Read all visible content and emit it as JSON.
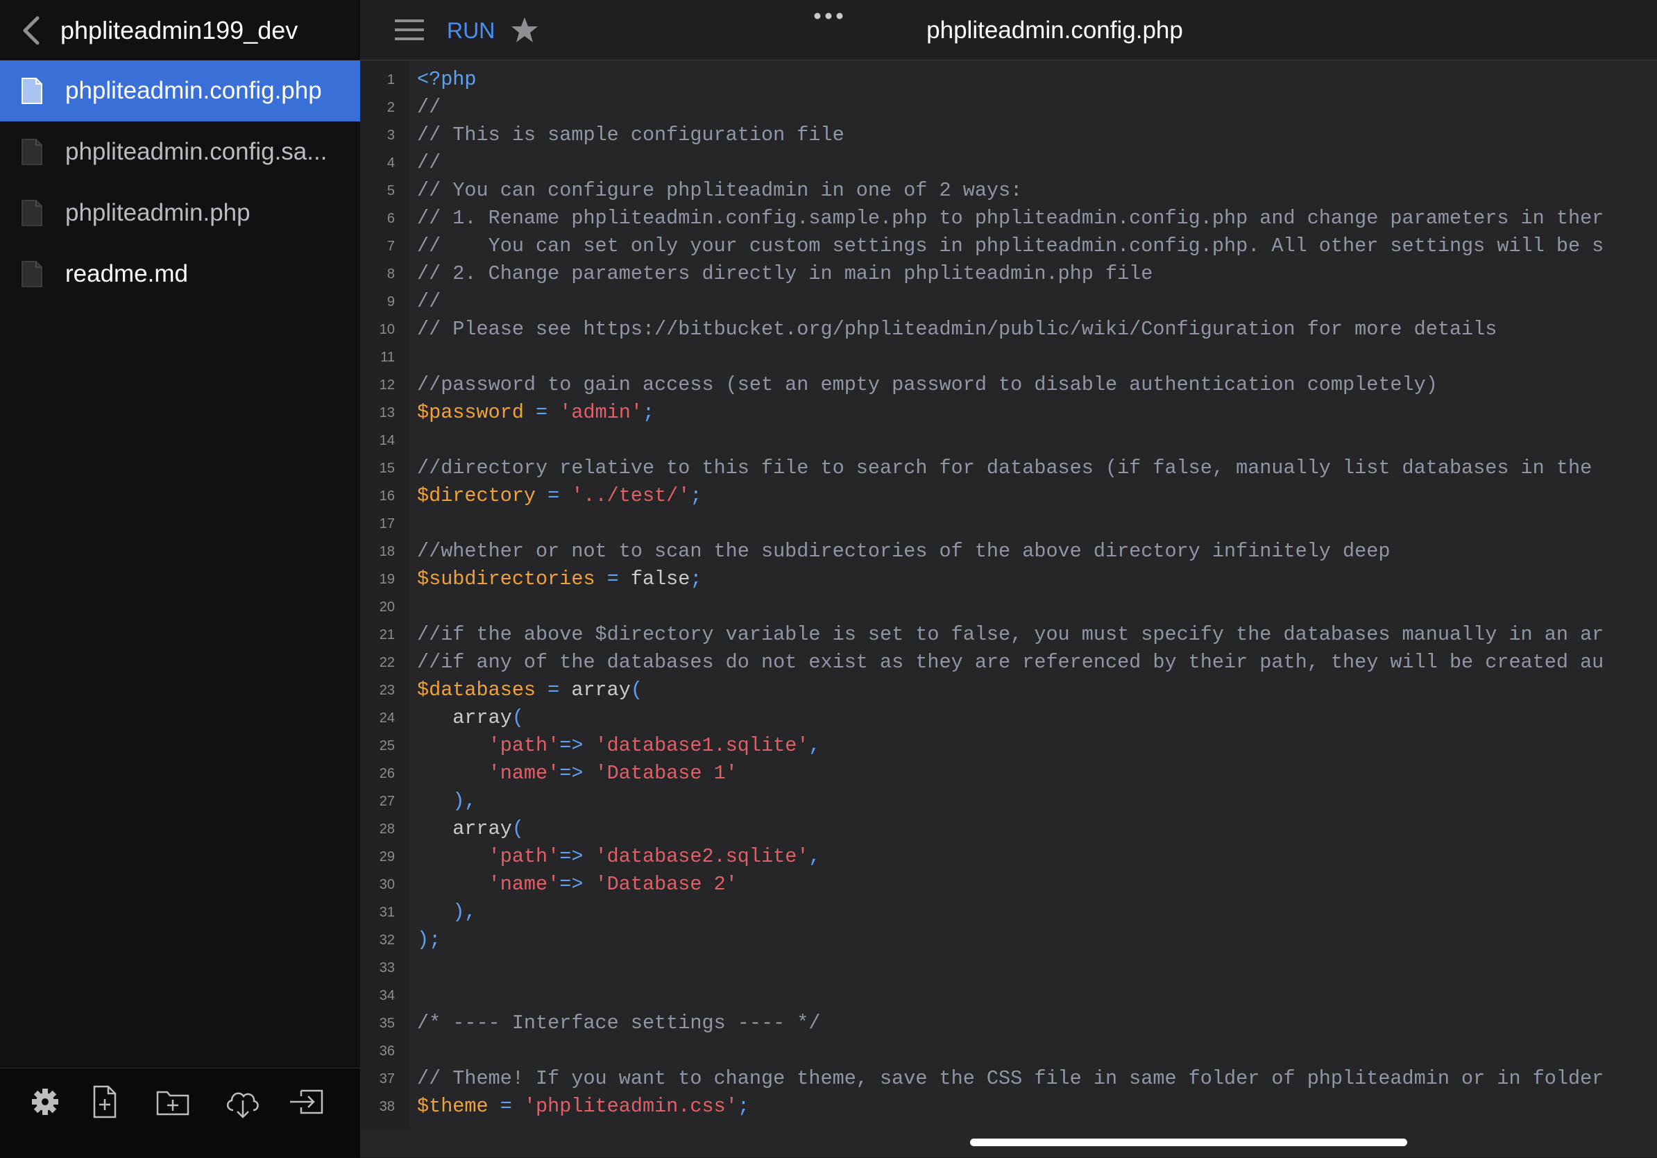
{
  "sidebar": {
    "folder_title": "phpliteadmin199_dev",
    "files": [
      {
        "label": "phpliteadmin.config.php"
      },
      {
        "label": "phpliteadmin.config.sa..."
      },
      {
        "label": "phpliteadmin.php"
      },
      {
        "label": "readme.md"
      }
    ],
    "toolbar_icons": [
      "settings-icon",
      "new-file-icon",
      "new-folder-icon",
      "cloud-download-icon",
      "import-icon"
    ]
  },
  "editor": {
    "run_label": "RUN",
    "title": "phpliteadmin.config.php",
    "lines": [
      "<?php",
      "//",
      "// This is sample configuration file",
      "//",
      "// You can configure phpliteadmin in one of 2 ways:",
      "// 1. Rename phpliteadmin.config.sample.php to phpliteadmin.config.php and change parameters in ther",
      "//    You can set only your custom settings in phpliteadmin.config.php. All other settings will be s",
      "// 2. Change parameters directly in main phpliteadmin.php file",
      "//",
      "// Please see https://bitbucket.org/phpliteadmin/public/wiki/Configuration for more details",
      "",
      "//password to gain access (set an empty password to disable authentication completely)",
      "$password = 'admin';",
      "",
      "//directory relative to this file to search for databases (if false, manually list databases in the",
      "$directory = '../test/';",
      "",
      "//whether or not to scan the subdirectories of the above directory infinitely deep",
      "$subdirectories = false;",
      "",
      "//if the above $directory variable is set to false, you must specify the databases manually in an ar",
      "//if any of the databases do not exist as they are referenced by their path, they will be created au",
      "$databases = array(",
      "   array(",
      "      'path'=> 'database1.sqlite',",
      "      'name'=> 'Database 1'",
      "   ),",
      "   array(",
      "      'path'=> 'database2.sqlite',",
      "      'name'=> 'Database 2'",
      "   ),",
      ");",
      "",
      "",
      "/* ---- Interface settings ---- */",
      "",
      "// Theme! If you want to change theme, save the CSS file in same folder of phpliteadmin or in folder",
      "$theme = 'phpliteadmin.css';"
    ]
  },
  "colors": {
    "accent": "#3a6fd8",
    "run": "#4c8ef7",
    "comment": "#8f97a6",
    "variable": "#f0a23a",
    "string": "#e25f67",
    "keyword": "#5fa0ef"
  }
}
